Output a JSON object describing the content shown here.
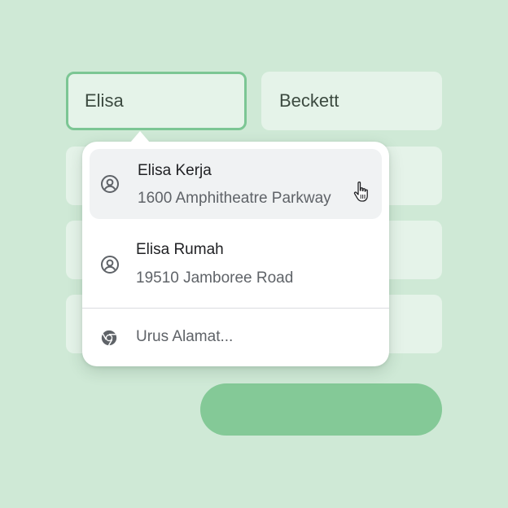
{
  "form": {
    "first_name_value": "Elisa",
    "last_name_value": "Beckett"
  },
  "autofill": {
    "suggestions": [
      {
        "title": "Elisa Kerja",
        "subtitle": "1600 Amphitheatre Parkway",
        "icon": "account-circle-icon"
      },
      {
        "title": "Elisa Rumah",
        "subtitle": "19510 Jamboree Road",
        "icon": "account-circle-icon"
      }
    ],
    "manage_label": "Urus Alamat...",
    "manage_icon": "chrome-icon"
  },
  "colors": {
    "background": "#cfe9d6",
    "field": "#e5f3e9",
    "focus_border": "#7cc694",
    "button": "#84c997"
  }
}
